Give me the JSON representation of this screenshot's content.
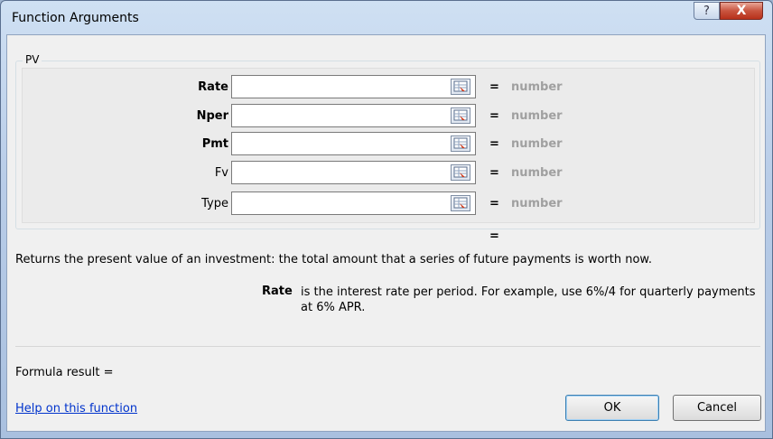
{
  "window": {
    "title": "Function Arguments",
    "help_glyph": "?",
    "close_glyph": "X"
  },
  "function": {
    "name": "PV",
    "arguments": [
      {
        "label": "Rate",
        "bold": true,
        "value": "",
        "result": "number"
      },
      {
        "label": "Nper",
        "bold": true,
        "value": "",
        "result": "number"
      },
      {
        "label": "Pmt",
        "bold": true,
        "value": "",
        "result": "number"
      },
      {
        "label": "Fv",
        "bold": false,
        "value": "",
        "result": "number"
      },
      {
        "label": "Type",
        "bold": false,
        "value": "",
        "result": "number"
      }
    ],
    "equals": "=",
    "result_equals": "="
  },
  "description": {
    "summary": "Returns the present value of an investment: the total amount that a series of future payments is worth now.",
    "arg_name": "Rate",
    "arg_text": "is the interest rate per period. For example, use 6%/4 for quarterly payments at 6% APR."
  },
  "footer": {
    "formula_result": "Formula result =",
    "help_link": "Help on this function",
    "ok_label": "OK",
    "cancel_label": "Cancel"
  },
  "colors": {
    "hint_gray": "#a0a0a0",
    "link_blue": "#0033cc",
    "close_red": "#c9553f"
  }
}
